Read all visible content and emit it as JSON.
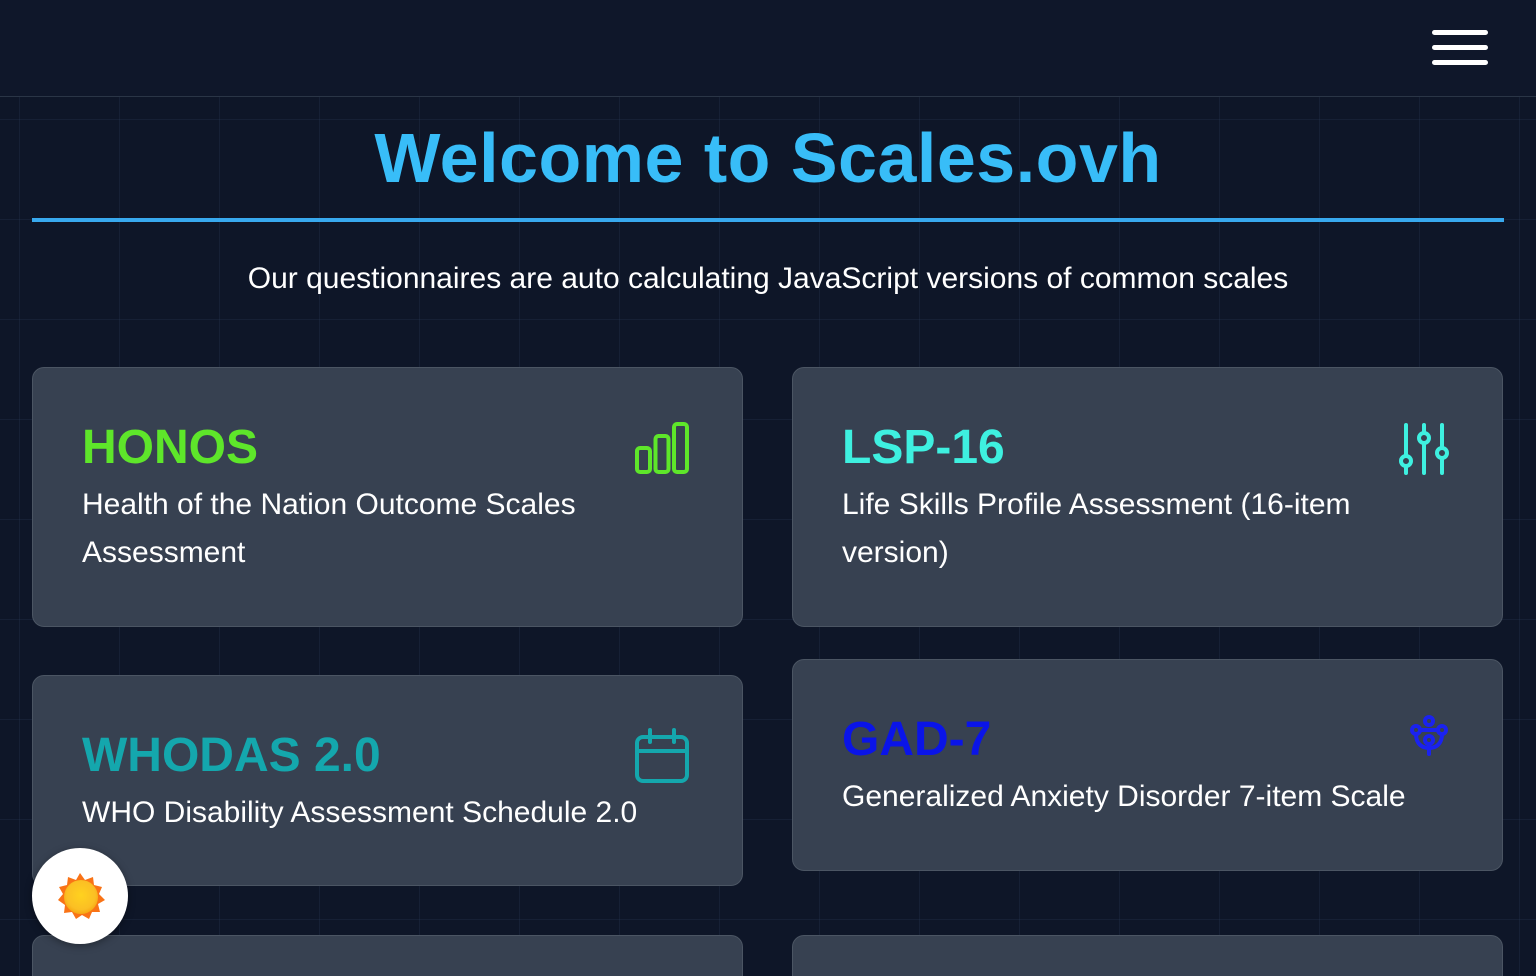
{
  "header": {
    "menu_icon": "hamburger-menu-icon"
  },
  "main": {
    "title": "Welcome to Scales.ovh",
    "subtitle": "Our questionnaires are auto calculating JavaScript versions of common scales"
  },
  "cards": [
    {
      "name": "HONOS",
      "description": "Health of the Nation Outcome Scales Assessment",
      "color": "#5ee62a",
      "icon": "bar-chart-icon"
    },
    {
      "name": "LSP-16",
      "description": "Life Skills Profile Assessment (16-item version)",
      "color": "#3ef0e0",
      "icon": "sliders-icon"
    },
    {
      "name": "WHODAS 2.0",
      "description": "WHO Disability Assessment Schedule 2.0",
      "color": "#14a7ad",
      "icon": "calendar-icon"
    },
    {
      "name": "GAD-7",
      "description": "Generalized Anxiety Disorder 7-item Scale",
      "color": "#0a14e8",
      "icon": "brain-icon"
    }
  ],
  "theme_toggle": {
    "icon": "sun-icon"
  }
}
